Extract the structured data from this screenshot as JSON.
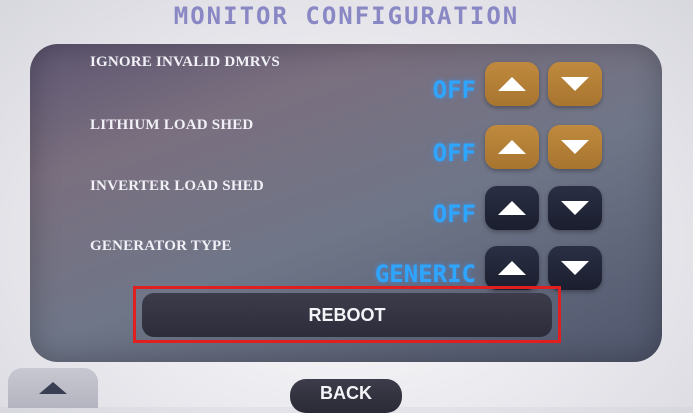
{
  "header": {
    "title": "MONITOR CONFIGURATION"
  },
  "settings": [
    {
      "label": "IGNORE INVALID DMRVS",
      "value": "OFF",
      "up_icon": "triangle-up-icon",
      "down_icon": "triangle-down-icon",
      "button_color": "#b0803a"
    },
    {
      "label": "LITHIUM LOAD SHED",
      "value": "OFF",
      "up_icon": "triangle-up-icon",
      "down_icon": "triangle-down-icon",
      "button_color": "#b0803a"
    },
    {
      "label": "INVERTER LOAD SHED",
      "value": "OFF",
      "up_icon": "triangle-up-icon",
      "down_icon": "triangle-down-icon",
      "button_color": "#1f2334"
    },
    {
      "label": "GENERATOR TYPE",
      "value": "GENERIC",
      "up_icon": "triangle-up-icon",
      "down_icon": "triangle-down-icon",
      "button_color": "#1f2334"
    }
  ],
  "actions": {
    "reboot_label": "REBOOT",
    "back_label": "BACK"
  },
  "colors": {
    "value_text": "#2ea6ff",
    "title_text": "#8a88c4",
    "highlight_border": "#e02020"
  }
}
